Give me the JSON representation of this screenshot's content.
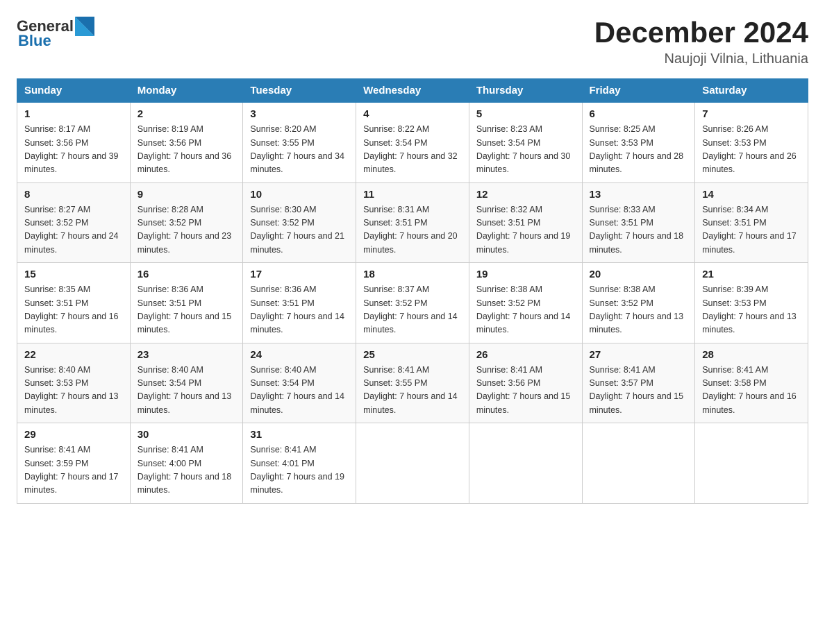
{
  "logo": {
    "text_general": "General",
    "text_blue": "Blue"
  },
  "title": {
    "month_year": "December 2024",
    "location": "Naujoji Vilnia, Lithuania"
  },
  "days_of_week": [
    "Sunday",
    "Monday",
    "Tuesday",
    "Wednesday",
    "Thursday",
    "Friday",
    "Saturday"
  ],
  "weeks": [
    [
      {
        "day": "1",
        "sunrise": "8:17 AM",
        "sunset": "3:56 PM",
        "daylight": "7 hours and 39 minutes."
      },
      {
        "day": "2",
        "sunrise": "8:19 AM",
        "sunset": "3:56 PM",
        "daylight": "7 hours and 36 minutes."
      },
      {
        "day": "3",
        "sunrise": "8:20 AM",
        "sunset": "3:55 PM",
        "daylight": "7 hours and 34 minutes."
      },
      {
        "day": "4",
        "sunrise": "8:22 AM",
        "sunset": "3:54 PM",
        "daylight": "7 hours and 32 minutes."
      },
      {
        "day": "5",
        "sunrise": "8:23 AM",
        "sunset": "3:54 PM",
        "daylight": "7 hours and 30 minutes."
      },
      {
        "day": "6",
        "sunrise": "8:25 AM",
        "sunset": "3:53 PM",
        "daylight": "7 hours and 28 minutes."
      },
      {
        "day": "7",
        "sunrise": "8:26 AM",
        "sunset": "3:53 PM",
        "daylight": "7 hours and 26 minutes."
      }
    ],
    [
      {
        "day": "8",
        "sunrise": "8:27 AM",
        "sunset": "3:52 PM",
        "daylight": "7 hours and 24 minutes."
      },
      {
        "day": "9",
        "sunrise": "8:28 AM",
        "sunset": "3:52 PM",
        "daylight": "7 hours and 23 minutes."
      },
      {
        "day": "10",
        "sunrise": "8:30 AM",
        "sunset": "3:52 PM",
        "daylight": "7 hours and 21 minutes."
      },
      {
        "day": "11",
        "sunrise": "8:31 AM",
        "sunset": "3:51 PM",
        "daylight": "7 hours and 20 minutes."
      },
      {
        "day": "12",
        "sunrise": "8:32 AM",
        "sunset": "3:51 PM",
        "daylight": "7 hours and 19 minutes."
      },
      {
        "day": "13",
        "sunrise": "8:33 AM",
        "sunset": "3:51 PM",
        "daylight": "7 hours and 18 minutes."
      },
      {
        "day": "14",
        "sunrise": "8:34 AM",
        "sunset": "3:51 PM",
        "daylight": "7 hours and 17 minutes."
      }
    ],
    [
      {
        "day": "15",
        "sunrise": "8:35 AM",
        "sunset": "3:51 PM",
        "daylight": "7 hours and 16 minutes."
      },
      {
        "day": "16",
        "sunrise": "8:36 AM",
        "sunset": "3:51 PM",
        "daylight": "7 hours and 15 minutes."
      },
      {
        "day": "17",
        "sunrise": "8:36 AM",
        "sunset": "3:51 PM",
        "daylight": "7 hours and 14 minutes."
      },
      {
        "day": "18",
        "sunrise": "8:37 AM",
        "sunset": "3:52 PM",
        "daylight": "7 hours and 14 minutes."
      },
      {
        "day": "19",
        "sunrise": "8:38 AM",
        "sunset": "3:52 PM",
        "daylight": "7 hours and 14 minutes."
      },
      {
        "day": "20",
        "sunrise": "8:38 AM",
        "sunset": "3:52 PM",
        "daylight": "7 hours and 13 minutes."
      },
      {
        "day": "21",
        "sunrise": "8:39 AM",
        "sunset": "3:53 PM",
        "daylight": "7 hours and 13 minutes."
      }
    ],
    [
      {
        "day": "22",
        "sunrise": "8:40 AM",
        "sunset": "3:53 PM",
        "daylight": "7 hours and 13 minutes."
      },
      {
        "day": "23",
        "sunrise": "8:40 AM",
        "sunset": "3:54 PM",
        "daylight": "7 hours and 13 minutes."
      },
      {
        "day": "24",
        "sunrise": "8:40 AM",
        "sunset": "3:54 PM",
        "daylight": "7 hours and 14 minutes."
      },
      {
        "day": "25",
        "sunrise": "8:41 AM",
        "sunset": "3:55 PM",
        "daylight": "7 hours and 14 minutes."
      },
      {
        "day": "26",
        "sunrise": "8:41 AM",
        "sunset": "3:56 PM",
        "daylight": "7 hours and 15 minutes."
      },
      {
        "day": "27",
        "sunrise": "8:41 AM",
        "sunset": "3:57 PM",
        "daylight": "7 hours and 15 minutes."
      },
      {
        "day": "28",
        "sunrise": "8:41 AM",
        "sunset": "3:58 PM",
        "daylight": "7 hours and 16 minutes."
      }
    ],
    [
      {
        "day": "29",
        "sunrise": "8:41 AM",
        "sunset": "3:59 PM",
        "daylight": "7 hours and 17 minutes."
      },
      {
        "day": "30",
        "sunrise": "8:41 AM",
        "sunset": "4:00 PM",
        "daylight": "7 hours and 18 minutes."
      },
      {
        "day": "31",
        "sunrise": "8:41 AM",
        "sunset": "4:01 PM",
        "daylight": "7 hours and 19 minutes."
      },
      null,
      null,
      null,
      null
    ]
  ]
}
